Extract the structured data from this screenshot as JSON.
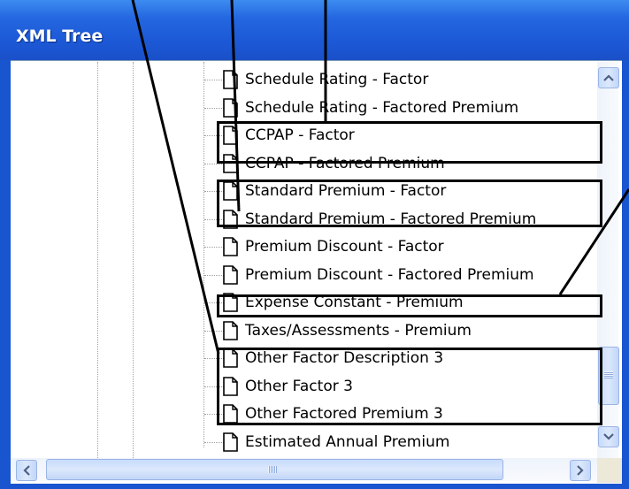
{
  "window": {
    "title": "XML Tree"
  },
  "tree": {
    "items": [
      {
        "label": "Schedule Rating - Factor"
      },
      {
        "label": "Schedule Rating - Factored Premium"
      },
      {
        "label": "CCPAP - Factor"
      },
      {
        "label": "CCPAP - Factored Premium"
      },
      {
        "label": "Standard Premium - Factor"
      },
      {
        "label": "Standard Premium - Factored Premium"
      },
      {
        "label": "Premium Discount - Factor"
      },
      {
        "label": "Premium Discount - Factored Premium"
      },
      {
        "label": "Expense Constant - Premium"
      },
      {
        "label": "Taxes/Assessments - Premium"
      },
      {
        "label": "Other Factor Description 3"
      },
      {
        "label": "Other Factor 3"
      },
      {
        "label": "Other Factored Premium 3"
      },
      {
        "label": "Estimated Annual Premium"
      }
    ]
  },
  "icons": {
    "node": "document-icon",
    "scroll_up": "up-arrow-icon",
    "scroll_down": "down-arrow-icon",
    "scroll_left": "left-arrow-icon",
    "scroll_right": "right-arrow-icon"
  },
  "colors": {
    "titlebar": "#1c58d6",
    "scrollbar": "#c8dcfb",
    "annotation": "#000000"
  }
}
